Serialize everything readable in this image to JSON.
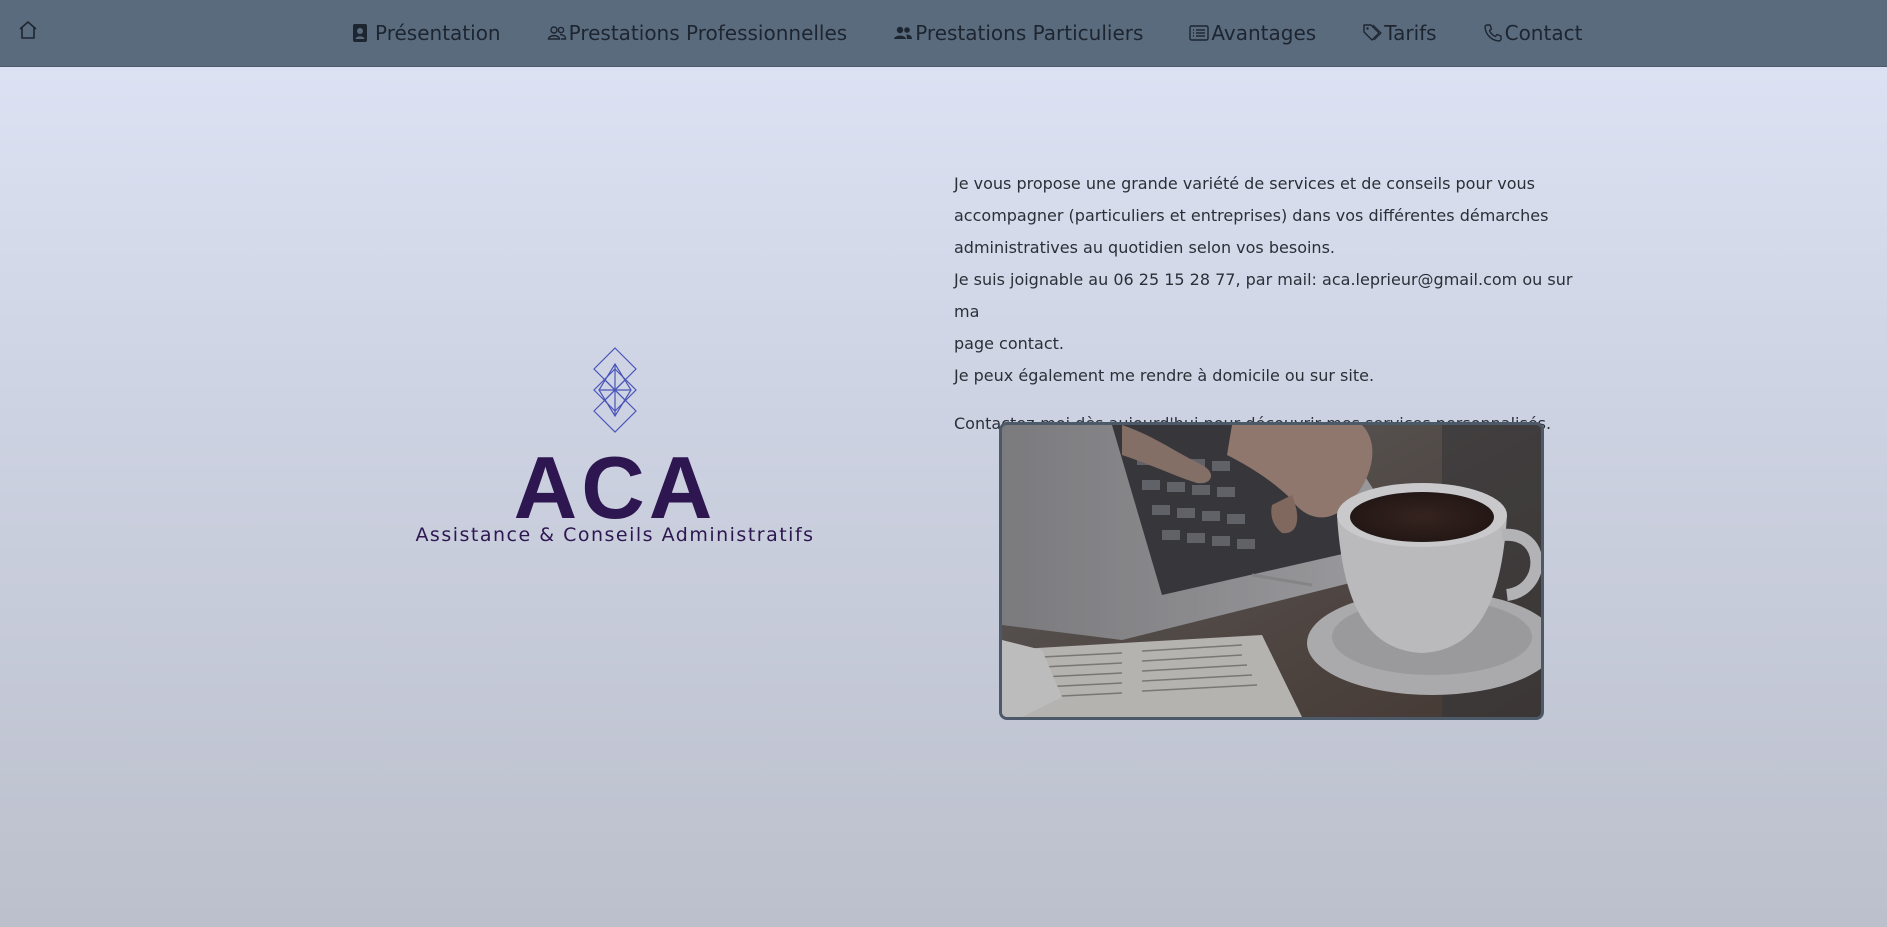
{
  "nav": {
    "home_icon": "home-icon",
    "items": [
      {
        "label": "Présentation",
        "icon": "person-badge-icon"
      },
      {
        "label": "Prestations Professionnelles",
        "icon": "people-outline-icon"
      },
      {
        "label": "Prestations Particuliers",
        "icon": "people-fill-icon"
      },
      {
        "label": "Avantages",
        "icon": "list-card-icon"
      },
      {
        "label": "Tarifs",
        "icon": "tags-icon"
      },
      {
        "label": "Contact",
        "icon": "phone-icon"
      }
    ]
  },
  "logo": {
    "title": "ACA",
    "subtitle": "Assistance & Conseils Administratifs",
    "color": "#2e1651",
    "mark_color": "#4a56b8"
  },
  "content": {
    "paragraph": [
      "Je vous propose une grande variété de services et de conseils pour vous",
      "accompagner (particuliers et entreprises) dans vos différentes démarches",
      "administratives au quotidien selon vos besoins.",
      "Je suis joignable au 06 25 15 28 77, par mail: aca.leprieur@gmail.com ou sur ma",
      "page contact.",
      "Je peux également me rendre à domicile ou sur site."
    ],
    "cta": "Contactez-moi dès aujourd'hui pour découvrir mes services personnalisés."
  },
  "photo": {
    "subject": "laptop keyboard with coffee cup and newspaper"
  },
  "colors": {
    "navbar": "#5a6b7e",
    "text": "#2b2f38"
  }
}
